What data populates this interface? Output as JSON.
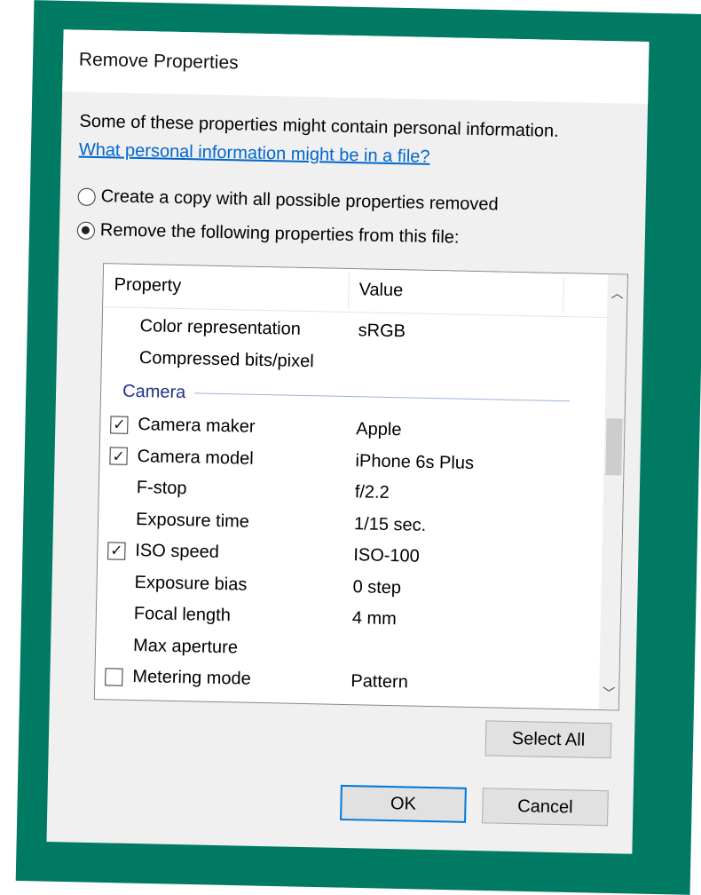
{
  "dialog": {
    "title": "Remove Properties",
    "info_text": "Some of these properties might contain personal information.",
    "link_text": "What personal information might be in a file?",
    "options": [
      {
        "label": "Create a copy with all possible properties removed",
        "selected": false
      },
      {
        "label": "Remove the following properties from this file:",
        "selected": true
      }
    ],
    "columns": {
      "property": "Property",
      "value": "Value"
    },
    "rows_top": [
      {
        "name": "Color representation",
        "value": "sRGB",
        "checkbox": false
      },
      {
        "name": "Compressed bits/pixel",
        "value": "",
        "checkbox": false
      }
    ],
    "group": "Camera",
    "rows": [
      {
        "name": "Camera maker",
        "value": "Apple",
        "checkbox": true,
        "checked": true
      },
      {
        "name": "Camera model",
        "value": "iPhone 6s Plus",
        "checkbox": true,
        "checked": true
      },
      {
        "name": "F-stop",
        "value": "f/2.2",
        "checkbox": false
      },
      {
        "name": "Exposure time",
        "value": "1/15 sec.",
        "checkbox": false
      },
      {
        "name": "ISO speed",
        "value": "ISO-100",
        "checkbox": true,
        "checked": true
      },
      {
        "name": "Exposure bias",
        "value": "0 step",
        "checkbox": false
      },
      {
        "name": "Focal length",
        "value": "4 mm",
        "checkbox": false
      },
      {
        "name": "Max aperture",
        "value": "",
        "checkbox": false
      },
      {
        "name": "Metering mode",
        "value": "Pattern",
        "checkbox": true,
        "checked": false
      }
    ],
    "buttons": {
      "select_all": "Select All",
      "ok": "OK",
      "cancel": "Cancel"
    },
    "colors": {
      "frame": "#007a62",
      "link": "#0066cc",
      "group": "#1e3287",
      "default_button_border": "#0078d7"
    }
  }
}
